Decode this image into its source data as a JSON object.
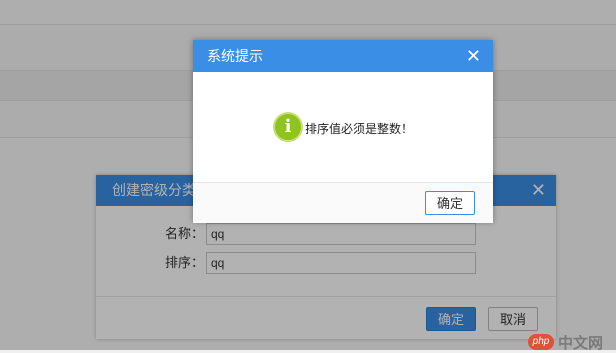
{
  "alert_dialog": {
    "title": "系统提示",
    "close_glyph": "✕",
    "message": "排序值必须是整数！",
    "icon": "info-icon",
    "icon_glyph": "i",
    "ok_label": "确定"
  },
  "category_dialog": {
    "title": "创建密级分类",
    "close_glyph": "✕",
    "fields": [
      {
        "label": "名称：",
        "value": "qq"
      },
      {
        "label": "排序：",
        "value": "qq"
      }
    ],
    "ok_label": "确定",
    "cancel_label": "取消"
  },
  "watermark": {
    "logo_text": "php",
    "site_text": "中文网"
  },
  "colors": {
    "header_blue": "#3a8ee6",
    "info_green": "#8fc31f"
  }
}
